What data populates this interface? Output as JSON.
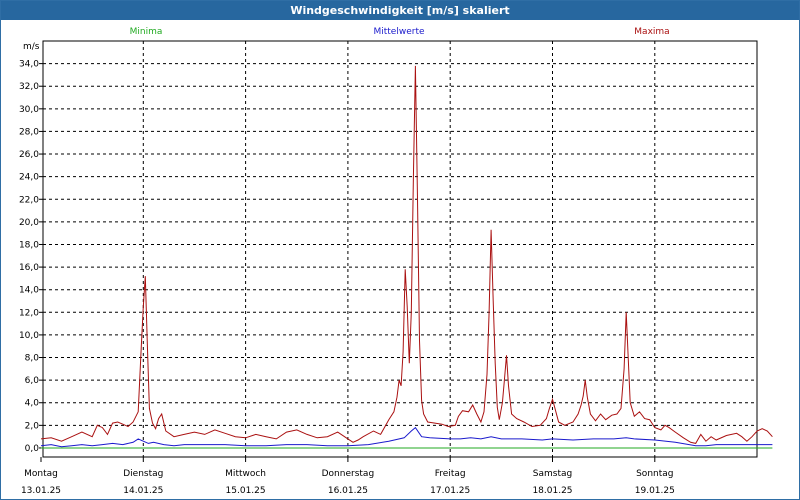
{
  "window": {
    "title": "Windgeschwindigkeit [m/s] skaliert"
  },
  "legend": [
    {
      "key": "min",
      "label": "Minima",
      "color": "#22aa22"
    },
    {
      "key": "mean",
      "label": "Mittelwerte",
      "color": "#1a1acc"
    },
    {
      "key": "max",
      "label": "Maxima",
      "color": "#aa1111"
    }
  ],
  "axis": {
    "unit": "m/s"
  },
  "chart_data": {
    "type": "line",
    "title": "Windgeschwindigkeit [m/s] skaliert",
    "ylabel": "m/s",
    "ylim": [
      -0.8,
      36
    ],
    "yticks": [
      0.0,
      2.0,
      4.0,
      6.0,
      8.0,
      10.0,
      12.0,
      14.0,
      16.0,
      18.0,
      20.0,
      22.0,
      24.0,
      26.0,
      28.0,
      30.0,
      32.0,
      34.0
    ],
    "ytick_labels": [
      "0,0",
      "2,0",
      "4,0",
      "6,0",
      "8,0",
      "10,0",
      "12,0",
      "14,0",
      "16,0",
      "18,0",
      "20,0",
      "22,0",
      "24,0",
      "26,0",
      "28,0",
      "30,0",
      "32,0",
      "34,0"
    ],
    "xlim": [
      0,
      7.15
    ],
    "day_ticks": [
      {
        "day": "Montag",
        "date": "13.01.25"
      },
      {
        "day": "Dienstag",
        "date": "14.01.25"
      },
      {
        "day": "Mittwoch",
        "date": "15.01.25"
      },
      {
        "day": "Donnerstag",
        "date": "16.01.25"
      },
      {
        "day": "Freitag",
        "date": "17.01.25"
      },
      {
        "day": "Samstag",
        "date": "18.01.25"
      },
      {
        "day": "Sonntag",
        "date": "19.01.25"
      }
    ],
    "grid": true,
    "series": [
      {
        "name": "Maxima",
        "color": "#aa1111",
        "points": [
          [
            0.0,
            0.8
          ],
          [
            0.1,
            0.9
          ],
          [
            0.2,
            0.6
          ],
          [
            0.3,
            1.0
          ],
          [
            0.4,
            1.4
          ],
          [
            0.5,
            1.0
          ],
          [
            0.55,
            2.0
          ],
          [
            0.6,
            1.8
          ],
          [
            0.65,
            1.2
          ],
          [
            0.7,
            2.2
          ],
          [
            0.75,
            2.3
          ],
          [
            0.8,
            2.1
          ],
          [
            0.85,
            1.9
          ],
          [
            0.9,
            2.3
          ],
          [
            0.95,
            3.2
          ],
          [
            0.98,
            9.0
          ],
          [
            1.0,
            12.5
          ],
          [
            1.02,
            15.2
          ],
          [
            1.04,
            9.0
          ],
          [
            1.06,
            3.5
          ],
          [
            1.09,
            2.2
          ],
          [
            1.12,
            1.7
          ],
          [
            1.15,
            2.6
          ],
          [
            1.18,
            3.0
          ],
          [
            1.22,
            1.5
          ],
          [
            1.3,
            1.0
          ],
          [
            1.4,
            1.2
          ],
          [
            1.5,
            1.4
          ],
          [
            1.6,
            1.2
          ],
          [
            1.7,
            1.6
          ],
          [
            1.8,
            1.3
          ],
          [
            1.9,
            1.0
          ],
          [
            2.0,
            0.9
          ],
          [
            2.1,
            1.2
          ],
          [
            2.2,
            1.0
          ],
          [
            2.3,
            0.8
          ],
          [
            2.4,
            1.4
          ],
          [
            2.5,
            1.6
          ],
          [
            2.6,
            1.2
          ],
          [
            2.7,
            0.9
          ],
          [
            2.8,
            1.0
          ],
          [
            2.9,
            1.4
          ],
          [
            3.0,
            0.8
          ],
          [
            3.05,
            0.5
          ],
          [
            3.1,
            0.7
          ],
          [
            3.15,
            1.0
          ],
          [
            3.25,
            1.5
          ],
          [
            3.32,
            1.2
          ],
          [
            3.4,
            2.5
          ],
          [
            3.45,
            3.2
          ],
          [
            3.48,
            4.5
          ],
          [
            3.5,
            6.0
          ],
          [
            3.52,
            5.5
          ],
          [
            3.54,
            8.5
          ],
          [
            3.56,
            15.8
          ],
          [
            3.58,
            12.5
          ],
          [
            3.6,
            7.5
          ],
          [
            3.62,
            12.0
          ],
          [
            3.64,
            24.0
          ],
          [
            3.66,
            33.8
          ],
          [
            3.68,
            22.0
          ],
          [
            3.7,
            9.5
          ],
          [
            3.72,
            4.2
          ],
          [
            3.74,
            3.0
          ],
          [
            3.78,
            2.3
          ],
          [
            3.85,
            2.2
          ],
          [
            3.92,
            2.1
          ],
          [
            3.98,
            1.9
          ],
          [
            4.05,
            2.0
          ],
          [
            4.08,
            2.8
          ],
          [
            4.12,
            3.3
          ],
          [
            4.18,
            3.2
          ],
          [
            4.22,
            3.8
          ],
          [
            4.26,
            3.0
          ],
          [
            4.3,
            2.3
          ],
          [
            4.33,
            3.2
          ],
          [
            4.36,
            6.5
          ],
          [
            4.38,
            12.0
          ],
          [
            4.4,
            19.3
          ],
          [
            4.42,
            13.0
          ],
          [
            4.44,
            7.5
          ],
          [
            4.46,
            3.6
          ],
          [
            4.48,
            2.5
          ],
          [
            4.51,
            4.0
          ],
          [
            4.53,
            6.0
          ],
          [
            4.55,
            8.2
          ],
          [
            4.57,
            5.5
          ],
          [
            4.6,
            3.0
          ],
          [
            4.65,
            2.6
          ],
          [
            4.72,
            2.3
          ],
          [
            4.8,
            1.9
          ],
          [
            4.88,
            2.0
          ],
          [
            4.94,
            2.6
          ],
          [
            4.97,
            3.5
          ],
          [
            5.0,
            4.3
          ],
          [
            5.03,
            3.3
          ],
          [
            5.06,
            2.3
          ],
          [
            5.12,
            2.0
          ],
          [
            5.2,
            2.3
          ],
          [
            5.25,
            3.0
          ],
          [
            5.28,
            3.8
          ],
          [
            5.3,
            4.6
          ],
          [
            5.32,
            6.0
          ],
          [
            5.34,
            4.5
          ],
          [
            5.37,
            3.0
          ],
          [
            5.42,
            2.4
          ],
          [
            5.47,
            3.0
          ],
          [
            5.52,
            2.5
          ],
          [
            5.58,
            2.9
          ],
          [
            5.63,
            3.0
          ],
          [
            5.67,
            3.5
          ],
          [
            5.7,
            7.0
          ],
          [
            5.72,
            12.0
          ],
          [
            5.74,
            8.0
          ],
          [
            5.76,
            4.0
          ],
          [
            5.8,
            2.8
          ],
          [
            5.85,
            3.2
          ],
          [
            5.9,
            2.6
          ],
          [
            5.95,
            2.5
          ],
          [
            6.0,
            1.8
          ],
          [
            6.06,
            1.6
          ],
          [
            6.1,
            2.0
          ],
          [
            6.14,
            1.8
          ],
          [
            6.2,
            1.4
          ],
          [
            6.28,
            0.9
          ],
          [
            6.35,
            0.5
          ],
          [
            6.4,
            0.4
          ],
          [
            6.45,
            1.2
          ],
          [
            6.5,
            0.6
          ],
          [
            6.55,
            1.0
          ],
          [
            6.6,
            0.7
          ],
          [
            6.7,
            1.1
          ],
          [
            6.8,
            1.3
          ],
          [
            6.85,
            1.0
          ],
          [
            6.9,
            0.6
          ],
          [
            6.95,
            1.0
          ],
          [
            7.0,
            1.5
          ],
          [
            7.05,
            1.7
          ],
          [
            7.1,
            1.5
          ],
          [
            7.15,
            1.0
          ]
        ]
      },
      {
        "name": "Mittelwerte",
        "color": "#1a1acc",
        "points": [
          [
            0.0,
            0.2
          ],
          [
            0.1,
            0.3
          ],
          [
            0.2,
            0.1
          ],
          [
            0.3,
            0.2
          ],
          [
            0.4,
            0.3
          ],
          [
            0.5,
            0.2
          ],
          [
            0.6,
            0.3
          ],
          [
            0.7,
            0.4
          ],
          [
            0.8,
            0.3
          ],
          [
            0.9,
            0.5
          ],
          [
            0.95,
            0.8
          ],
          [
            1.0,
            0.6
          ],
          [
            1.05,
            0.4
          ],
          [
            1.1,
            0.5
          ],
          [
            1.2,
            0.3
          ],
          [
            1.3,
            0.2
          ],
          [
            1.4,
            0.3
          ],
          [
            1.6,
            0.3
          ],
          [
            1.8,
            0.3
          ],
          [
            2.0,
            0.2
          ],
          [
            2.2,
            0.2
          ],
          [
            2.4,
            0.3
          ],
          [
            2.6,
            0.3
          ],
          [
            2.8,
            0.2
          ],
          [
            3.0,
            0.2
          ],
          [
            3.2,
            0.3
          ],
          [
            3.4,
            0.6
          ],
          [
            3.55,
            0.9
          ],
          [
            3.62,
            1.5
          ],
          [
            3.66,
            1.8
          ],
          [
            3.72,
            1.0
          ],
          [
            3.8,
            0.9
          ],
          [
            4.0,
            0.8
          ],
          [
            4.1,
            0.8
          ],
          [
            4.2,
            0.9
          ],
          [
            4.3,
            0.8
          ],
          [
            4.4,
            1.0
          ],
          [
            4.5,
            0.8
          ],
          [
            4.7,
            0.8
          ],
          [
            4.9,
            0.7
          ],
          [
            5.0,
            0.8
          ],
          [
            5.2,
            0.7
          ],
          [
            5.4,
            0.8
          ],
          [
            5.6,
            0.8
          ],
          [
            5.72,
            0.9
          ],
          [
            5.8,
            0.8
          ],
          [
            6.0,
            0.7
          ],
          [
            6.2,
            0.5
          ],
          [
            6.4,
            0.2
          ],
          [
            6.5,
            0.2
          ],
          [
            6.6,
            0.3
          ],
          [
            6.8,
            0.3
          ],
          [
            7.0,
            0.3
          ],
          [
            7.15,
            0.3
          ]
        ]
      },
      {
        "name": "Minima",
        "color": "#22aa22",
        "points": [
          [
            0.0,
            0.0
          ],
          [
            7.15,
            0.0
          ]
        ]
      }
    ]
  }
}
